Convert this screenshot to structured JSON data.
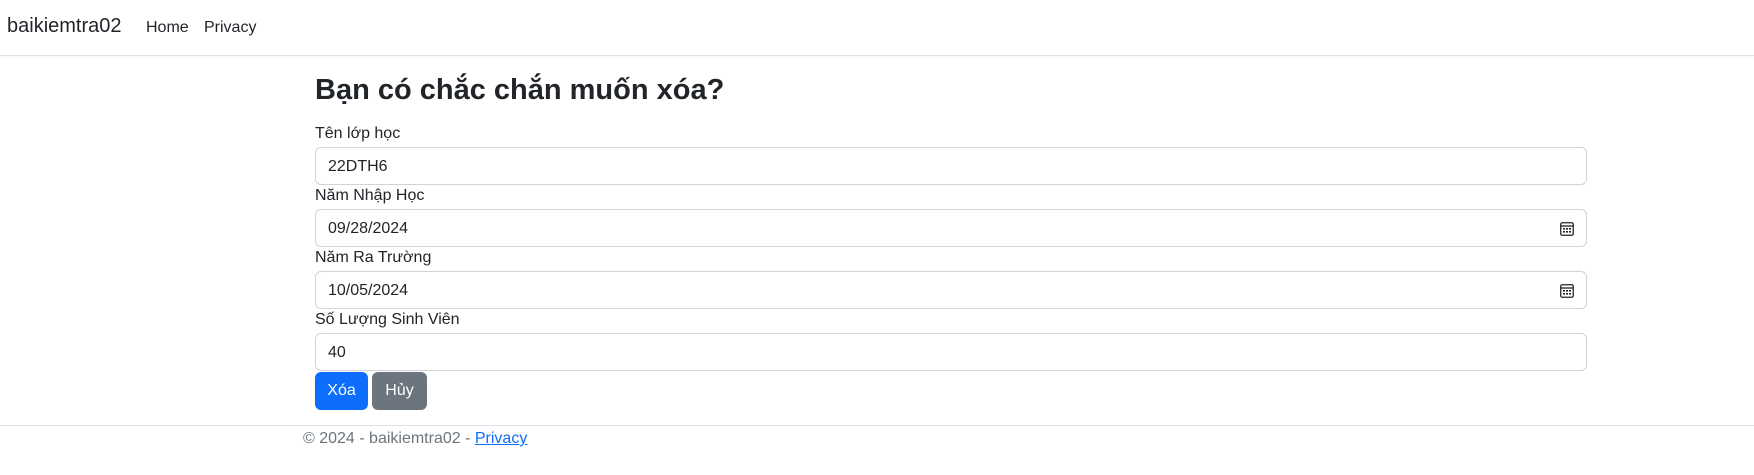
{
  "nav": {
    "brand": "baikiemtra02",
    "home": "Home",
    "privacy": "Privacy"
  },
  "page": {
    "title": "Bạn có chắc chắn muốn xóa?"
  },
  "form": {
    "fields": [
      {
        "label": "Tên lớp học",
        "value": "22DTH6"
      },
      {
        "label": "Năm Nhập Học",
        "value": "09/28/2024",
        "icon": "calendar-icon"
      },
      {
        "label": "Năm Ra Trường",
        "value": "10/05/2024",
        "icon": "calendar-icon"
      },
      {
        "label": "Số Lượng Sinh Viên",
        "value": "40"
      }
    ],
    "delete_label": "Xóa",
    "cancel_label": "Hủy"
  },
  "footer": {
    "text": "© 2024 - baikiemtra02 - ",
    "privacy": "Privacy"
  },
  "colors": {
    "primary": "#0d6efd",
    "secondary": "#6c757d",
    "border": "#ced4da"
  }
}
